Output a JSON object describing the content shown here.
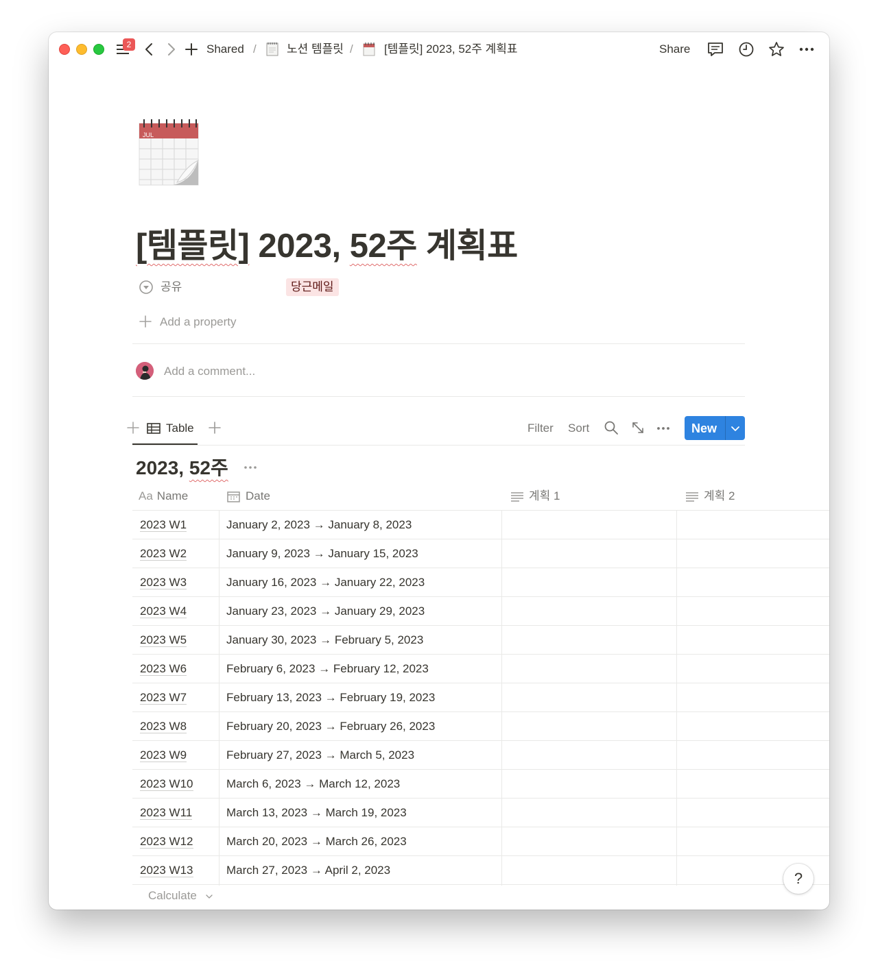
{
  "topbar": {
    "notification_count": "2",
    "breadcrumb": {
      "root": "Shared",
      "sep": "/",
      "parent": "노션 템플릿",
      "current": "[템플릿] 2023, 52주 계획표"
    },
    "share_label": "Share",
    "icons": [
      "sidebar-menu-icon",
      "back-icon",
      "forward-icon",
      "new-page-icon",
      "notepad-icon",
      "calendar-icon",
      "comment-icon",
      "clock-icon",
      "star-icon",
      "more-icon"
    ]
  },
  "page": {
    "icon": "spiral-calendar-icon",
    "icon_month": "JUL",
    "title_prefix": "[템플릿]",
    "title_mid": " 2023, ",
    "title_word": "52주",
    "title_suffix": " 계획표",
    "property": {
      "icon": "select-status-icon",
      "label": "공유",
      "value": "당근메일",
      "value_color": "#fbe4e4"
    },
    "add_property_label": "Add a property",
    "comment_placeholder": "Add a comment..."
  },
  "database": {
    "view_label": "Table",
    "filter_label": "Filter",
    "sort_label": "Sort",
    "new_label": "New",
    "new_button_color": "#2e83e0",
    "title_year": "2023, ",
    "title_week": "52주",
    "columns": [
      {
        "icon": "Aa",
        "label": "Name"
      },
      {
        "icon": "calendar-prop-icon",
        "label": "Date"
      },
      {
        "icon": "text-prop-icon",
        "label": "계획 1"
      },
      {
        "icon": "text-prop-icon",
        "label": "계획 2"
      }
    ],
    "rows": [
      {
        "name": "2023 W1",
        "date": "January 2, 2023 → January 8, 2023"
      },
      {
        "name": "2023 W2",
        "date": "January 9, 2023 → January 15, 2023"
      },
      {
        "name": "2023 W3",
        "date": "January 16, 2023 → January 22, 2023"
      },
      {
        "name": "2023 W4",
        "date": "January 23, 2023 → January 29, 2023"
      },
      {
        "name": "2023 W5",
        "date": "January 30, 2023 → February 5, 2023"
      },
      {
        "name": "2023 W6",
        "date": "February 6, 2023 → February 12, 2023"
      },
      {
        "name": "2023 W7",
        "date": "February 13, 2023 → February 19, 2023"
      },
      {
        "name": "2023 W8",
        "date": "February 20, 2023 → February 26, 2023"
      },
      {
        "name": "2023 W9",
        "date": "February 27, 2023 → March 5, 2023"
      },
      {
        "name": "2023 W10",
        "date": "March 6, 2023 → March 12, 2023"
      },
      {
        "name": "2023 W11",
        "date": "March 13, 2023 → March 19, 2023"
      },
      {
        "name": "2023 W12",
        "date": "March 20, 2023 → March 26, 2023"
      },
      {
        "name": "2023 W13",
        "date": "March 27, 2023 → April 2, 2023"
      }
    ],
    "calculate_label": "Calculate"
  },
  "help_label": "?"
}
